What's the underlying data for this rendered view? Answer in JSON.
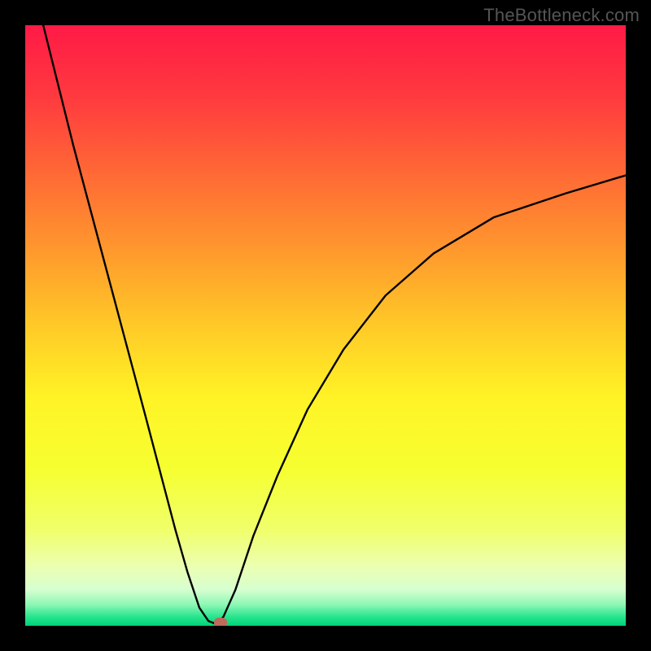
{
  "watermark": "TheBottleneck.com",
  "chart_data": {
    "type": "line",
    "title": "",
    "xlabel": "",
    "ylabel": "",
    "xlim": [
      0,
      100
    ],
    "ylim": [
      0,
      100
    ],
    "grid": false,
    "legend": false,
    "series": [
      {
        "name": "curve",
        "x": [
          3,
          5,
          8,
          12,
          16,
          20,
          25,
          27,
          29,
          30.5,
          31.5,
          32,
          33,
          35,
          38,
          42,
          47,
          53,
          60,
          68,
          78,
          90,
          100
        ],
        "values": [
          100,
          92,
          80,
          65,
          50,
          35,
          16,
          9,
          3,
          0.8,
          0.4,
          0.4,
          1.5,
          6,
          15,
          25,
          36,
          46,
          55,
          62,
          68,
          72,
          75
        ]
      }
    ],
    "marker": {
      "x": 32.5,
      "y": 0.6,
      "color": "#bf6a5a"
    },
    "gradient_stops": [
      {
        "pos": 0.0,
        "color": "#ff1a46"
      },
      {
        "pos": 0.12,
        "color": "#ff3a3f"
      },
      {
        "pos": 0.25,
        "color": "#ff6a35"
      },
      {
        "pos": 0.38,
        "color": "#ff9a2d"
      },
      {
        "pos": 0.5,
        "color": "#ffc927"
      },
      {
        "pos": 0.62,
        "color": "#fff326"
      },
      {
        "pos": 0.74,
        "color": "#f6ff31"
      },
      {
        "pos": 0.84,
        "color": "#f0ff6a"
      },
      {
        "pos": 0.9,
        "color": "#ecffb0"
      },
      {
        "pos": 0.94,
        "color": "#d6ffd0"
      },
      {
        "pos": 0.965,
        "color": "#8cf7b4"
      },
      {
        "pos": 0.985,
        "color": "#28e58e"
      },
      {
        "pos": 1.0,
        "color": "#00d477"
      }
    ],
    "curve_style": {
      "stroke": "#000000",
      "width": 2.4
    }
  }
}
